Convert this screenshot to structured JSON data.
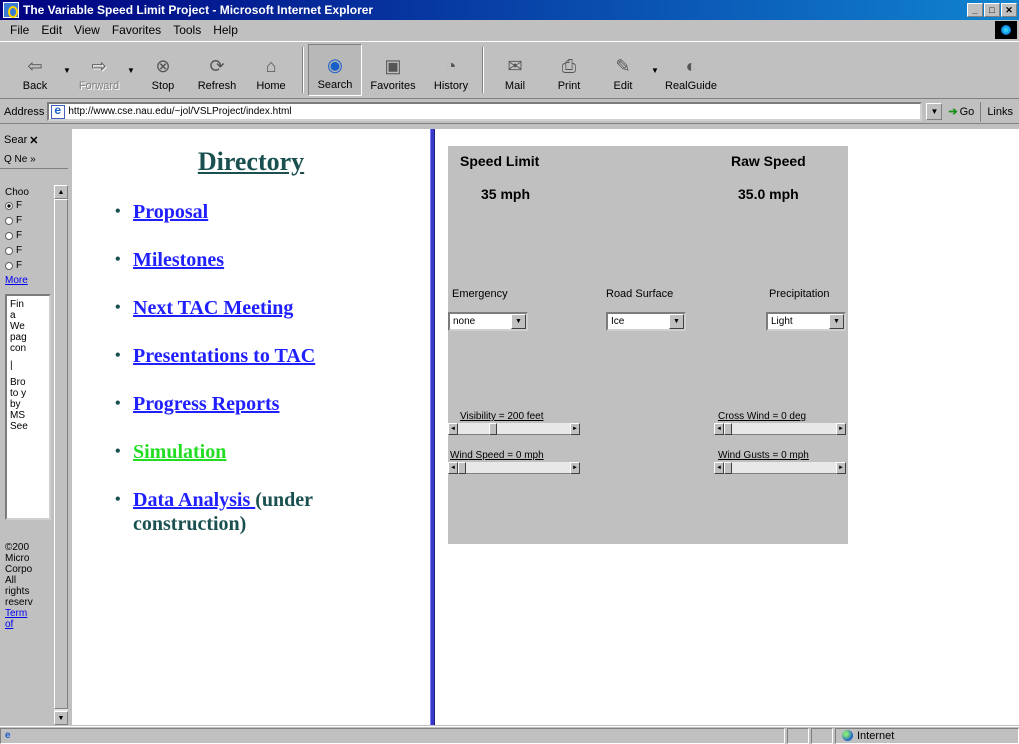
{
  "window": {
    "title": "The Variable Speed Limit Project - Microsoft Internet Explorer",
    "controls": [
      "_",
      "□",
      "✕"
    ]
  },
  "menu": [
    "File",
    "Edit",
    "View",
    "Favorites",
    "Tools",
    "Help"
  ],
  "toolbar": {
    "back": "Back",
    "forward": "Forward",
    "stop": "Stop",
    "refresh": "Refresh",
    "home": "Home",
    "search": "Search",
    "favorites": "Favorites",
    "history": "History",
    "mail": "Mail",
    "print": "Print",
    "edit": "Edit",
    "realguide": "RealGuide"
  },
  "address": {
    "label": "Address",
    "url": "http://www.cse.nau.edu/~jol/VSLProject/index.html",
    "go": "Go",
    "links": "Links"
  },
  "search_pane": {
    "title": "Sear",
    "tool": "Q Ne »",
    "choose": "Choo",
    "options": [
      "F",
      "F",
      "F",
      "F",
      "F"
    ],
    "selected_index": 0,
    "more": "More",
    "box_text": [
      "Fin",
      "a",
      "We",
      "pag",
      "con"
    ],
    "box_text2": [
      "Bro",
      "to y",
      "by",
      "MS",
      "See"
    ],
    "legal": [
      "©200",
      "Micro",
      "Corpo",
      "All",
      "rights",
      "reserv"
    ],
    "terms": [
      "Term",
      "of"
    ]
  },
  "directory": {
    "title": "Directory",
    "items": [
      {
        "label": "Proposal"
      },
      {
        "label": "Milestones"
      },
      {
        "label": "Next TAC Meeting"
      },
      {
        "label": "Presentations to TAC"
      },
      {
        "label": "Progress Reports"
      },
      {
        "label": "Simulation"
      },
      {
        "label": "Data Analysis ",
        "tail_1": "(under",
        "tail_2": "construction)"
      }
    ]
  },
  "applet": {
    "speed_limit_label": "Speed Limit",
    "speed_limit_value": "35 mph",
    "raw_speed_label": "Raw Speed",
    "raw_speed_value": "35.0 mph",
    "emergency_label": "Emergency",
    "emergency_value": "none",
    "road_surface_label": "Road Surface",
    "road_surface_value": "Ice",
    "precipitation_label": "Precipitation",
    "precipitation_value": "Light",
    "visibility_label": "Visibility = 200 feet",
    "cross_wind_label": "Cross Wind = 0 deg",
    "wind_speed_label": "Wind Speed = 0 mph",
    "wind_gusts_label": "Wind Gusts = 0 mph",
    "visibility_level": 0.3,
    "cross_wind_level": 0.0,
    "wind_speed_level": 0.0,
    "wind_gusts_level": 0.0
  },
  "status": {
    "zone": "Internet"
  }
}
